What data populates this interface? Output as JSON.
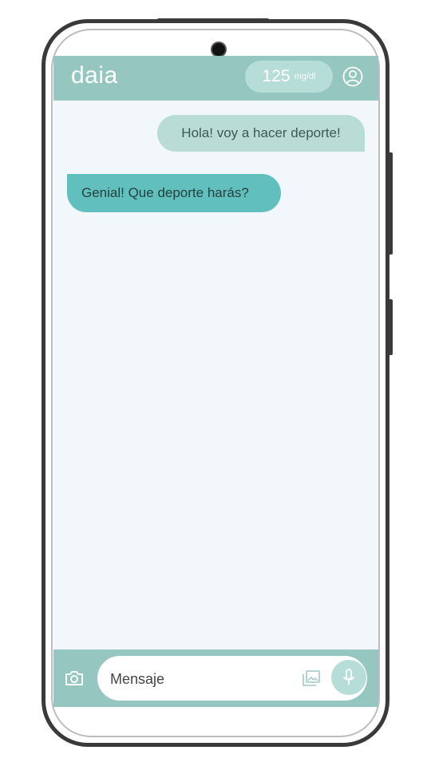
{
  "app": {
    "logo": "daia"
  },
  "header": {
    "glucose_value": "125",
    "glucose_unit": "mg/dl",
    "profile_icon": "user-circle-icon"
  },
  "chat": {
    "messages": [
      {
        "sender": "user",
        "text": "Hola! voy a hacer deporte!"
      },
      {
        "sender": "bot",
        "text": "Genial! Que deporte harás?"
      }
    ]
  },
  "composer": {
    "placeholder": "Mensaje",
    "camera_icon": "camera-icon",
    "gallery_icon": "gallery-icon",
    "mic_icon": "microphone-icon"
  },
  "colors": {
    "header": "#95c6bf",
    "sent_bubble": "#b9ddd6",
    "received_bubble": "#61c0bd",
    "screen_bg": "#f1f7fa"
  }
}
